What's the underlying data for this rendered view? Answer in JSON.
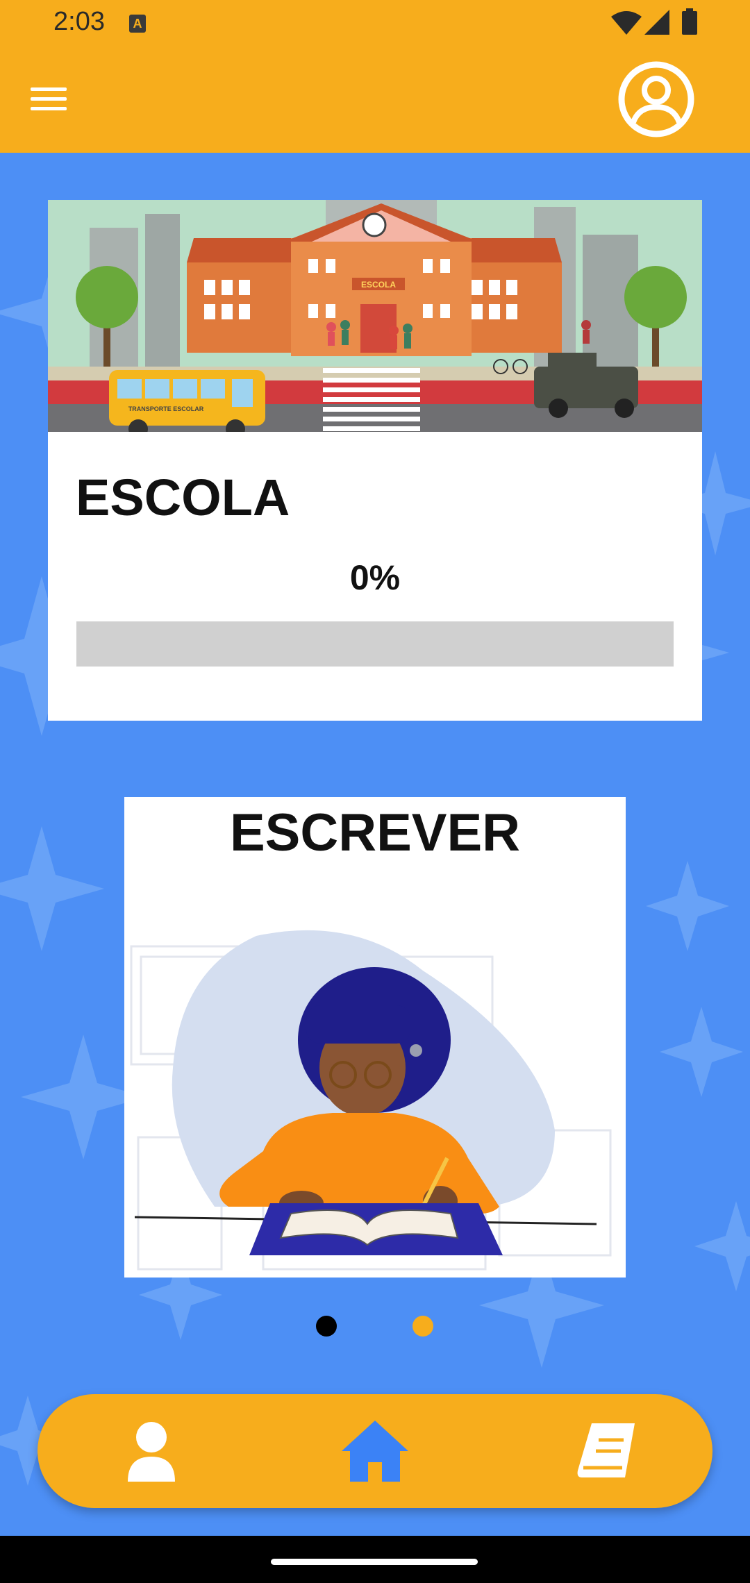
{
  "status_bar": {
    "time": "2:03",
    "notification_icon": "a-icon",
    "icons": [
      "wifi-icon",
      "signal-icon",
      "battery-icon"
    ]
  },
  "app_bar": {
    "menu_icon": "hamburger-menu-icon",
    "profile_icon": "account-circle-icon"
  },
  "card_school": {
    "title": "ESCOLA",
    "progress_text": "0%",
    "progress_value": 0,
    "image_labels": {
      "building_sign": "ESCOLA",
      "bus_sign": "TRANSPORTE ESCOLAR"
    }
  },
  "card_write": {
    "title": "ESCREVER"
  },
  "carousel": {
    "active_index": 0,
    "count": 2
  },
  "bottom_nav": [
    {
      "icon": "person-icon"
    },
    {
      "icon": "home-icon"
    },
    {
      "icon": "book-icon"
    }
  ],
  "colors": {
    "primary": "#f7ad1c",
    "background": "#4d8ff5",
    "home_icon": "#3b82f6",
    "white": "#ffffff"
  }
}
